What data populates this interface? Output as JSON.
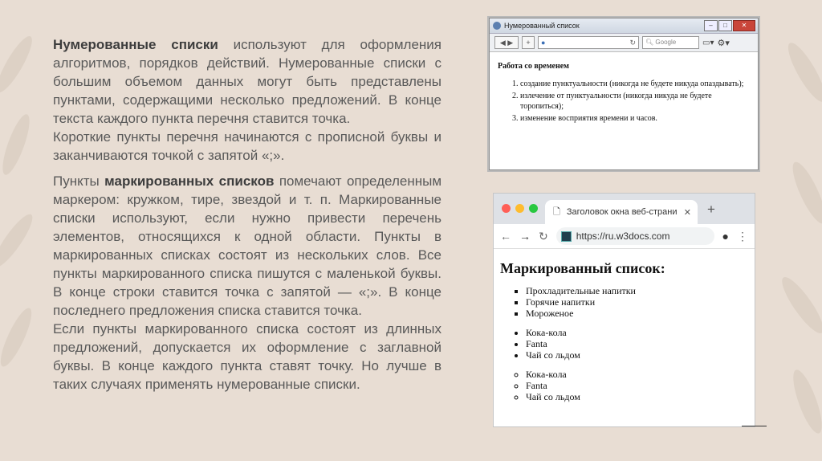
{
  "text": {
    "p1_bold": "Нумерованные списки",
    "p1_rest": " используют для оформления алгоритмов, порядков действий. Нумерованные списки с большим объемом данных могут быть представлены пунктами, содержащими несколько предложений. В конце текста каждого пункта перечня ставится точка.",
    "p2": "Короткие пункты перечня начинаются с прописной буквы и заканчиваются точкой с запятой «;».",
    "p3_start": "Пункты ",
    "p3_bold": "маркированных списков",
    "p3_rest": " помечают определенным маркером: кружком, тире, звездой и т. п. Маркированные списки используют, если нужно привести перечень элементов, относящихся к одной области. Пункты в маркированных списках состоят из нескольких слов. Все пункты маркированного списка пишутся с маленькой буквы. В конце строки ставится точка с запятой — «;». В конце последнего предложения списка ставится точка.",
    "p4": "Если пункты маркированного списка состоят из длинных предложений, допускается их оформление с заглавной буквы. В конце каждого пункта ставят точку. Но лучше в таких случаях применять нумерованные списки."
  },
  "screenshot1": {
    "window_title": "Нумерованный список",
    "search_placeholder": "Google",
    "heading": "Работа со временем",
    "items": [
      "создание пунктуальности (никогда не будете никуда опаздывать);",
      "излечение от пунктуальности (никогда никуда не будете торопиться);",
      "изменение восприятия времени и часов."
    ]
  },
  "screenshot2": {
    "tab_title": "Заголовок окна веб-страницы",
    "url": "https://ru.w3docs.com",
    "heading": "Маркированный список:",
    "list1": [
      "Прохладительные напитки",
      "Горячие напитки",
      "Мороженое"
    ],
    "list2": [
      "Кока-кола",
      "Fanta",
      "Чай со льдом"
    ],
    "list3": [
      "Кока-кола",
      "Fanta",
      "Чай со льдом"
    ]
  },
  "colors": {
    "background": "#e8ddd3",
    "text": "#595959",
    "mac_red": "#ff5f57",
    "mac_yellow": "#febc2e",
    "mac_green": "#28c840"
  }
}
